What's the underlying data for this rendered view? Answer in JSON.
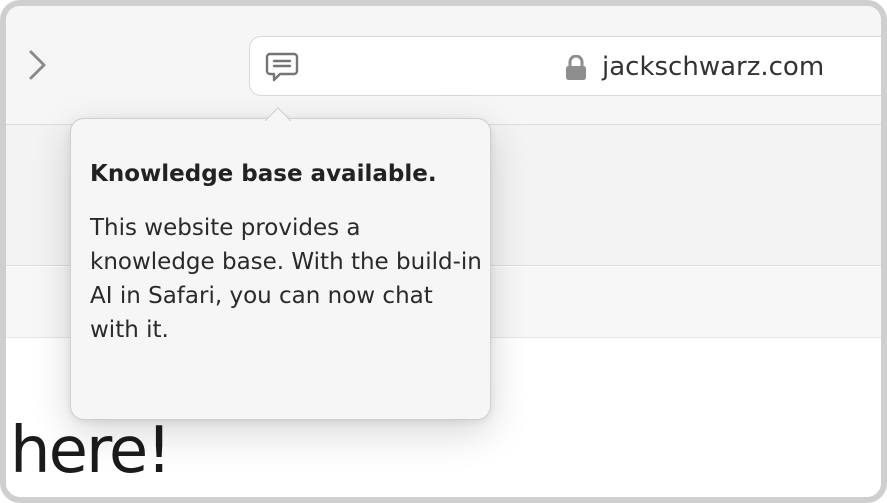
{
  "toolbar": {
    "forward_icon": "chevron-right-icon",
    "chat_icon": "chat-bubble-icon",
    "lock_icon": "lock-icon",
    "url": "jackschwarz.com"
  },
  "popover": {
    "title": "Knowledge base available.",
    "body": "This website provides a knowledge base. With the build-in AI in Safari, you can now chat with it."
  },
  "page": {
    "heading": "here!"
  },
  "colors": {
    "frame": "#cfcfcf",
    "toolbar_bg": "#f6f6f6",
    "popover_bg": "#f6f6f6",
    "icon": "#7a7a7a",
    "lock": "#8e8e8e"
  }
}
